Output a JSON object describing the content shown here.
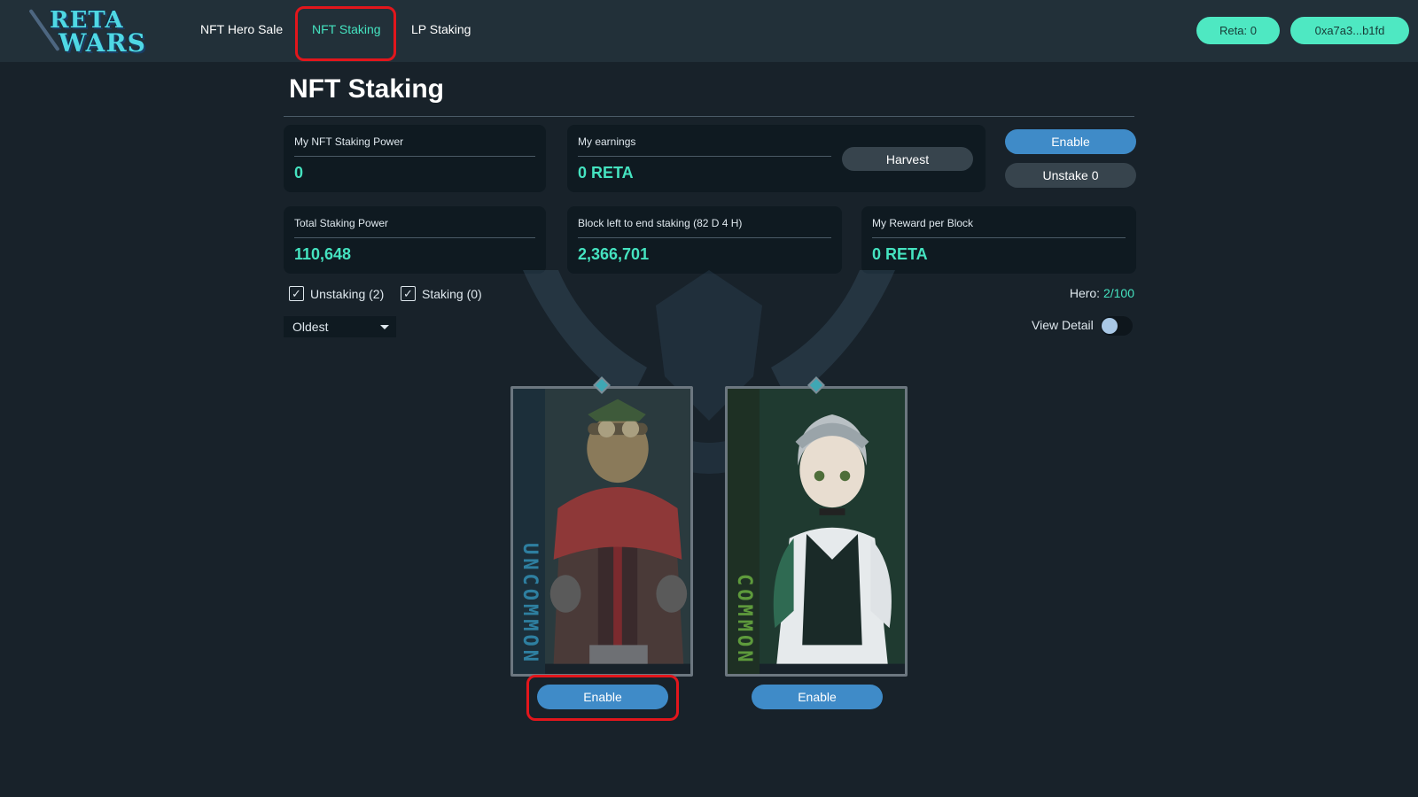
{
  "header": {
    "logo": {
      "line1": "RETA",
      "line2": "WARS"
    },
    "nav": [
      {
        "label": "NFT Hero Sale",
        "active": false
      },
      {
        "label": "NFT Staking",
        "active": true
      },
      {
        "label": "LP Staking",
        "active": false
      }
    ],
    "balance": "Reta: 0",
    "wallet": "0xa7a3...b1fd"
  },
  "page": {
    "title": "NFT Staking"
  },
  "stats": {
    "my_power": {
      "label": "My NFT Staking Power",
      "value": "0"
    },
    "earnings": {
      "label": "My earnings",
      "value": "0 RETA",
      "harvest_label": "Harvest"
    },
    "enable_label": "Enable",
    "unstake_label": "Unstake 0",
    "total_power": {
      "label": "Total Staking Power",
      "value": "110,648"
    },
    "blocks_left": {
      "label": "Block left to end staking (82 D 4 H)",
      "value": "2,366,701"
    },
    "reward_per_block": {
      "label": "My Reward per Block",
      "value": "0 RETA"
    }
  },
  "filters": {
    "unstaking": {
      "label": "Unstaking (2)",
      "checked": true
    },
    "staking": {
      "label": "Staking (0)",
      "checked": true
    },
    "sort_selected": "Oldest",
    "hero_label": "Hero: ",
    "hero_count": "2/100",
    "view_detail_label": "View Detail",
    "view_detail_on": false
  },
  "heroes": [
    {
      "rarity": "UNCOMMON",
      "rarity_color": "#2e7fa0",
      "button_label": "Enable"
    },
    {
      "rarity": "COMMON",
      "rarity_color": "#5e9a3c",
      "button_label": "Enable"
    }
  ],
  "colors": {
    "accent": "#45e3c0",
    "button_blue": "#3f8bc8",
    "highlight_red": "#e2161c"
  }
}
